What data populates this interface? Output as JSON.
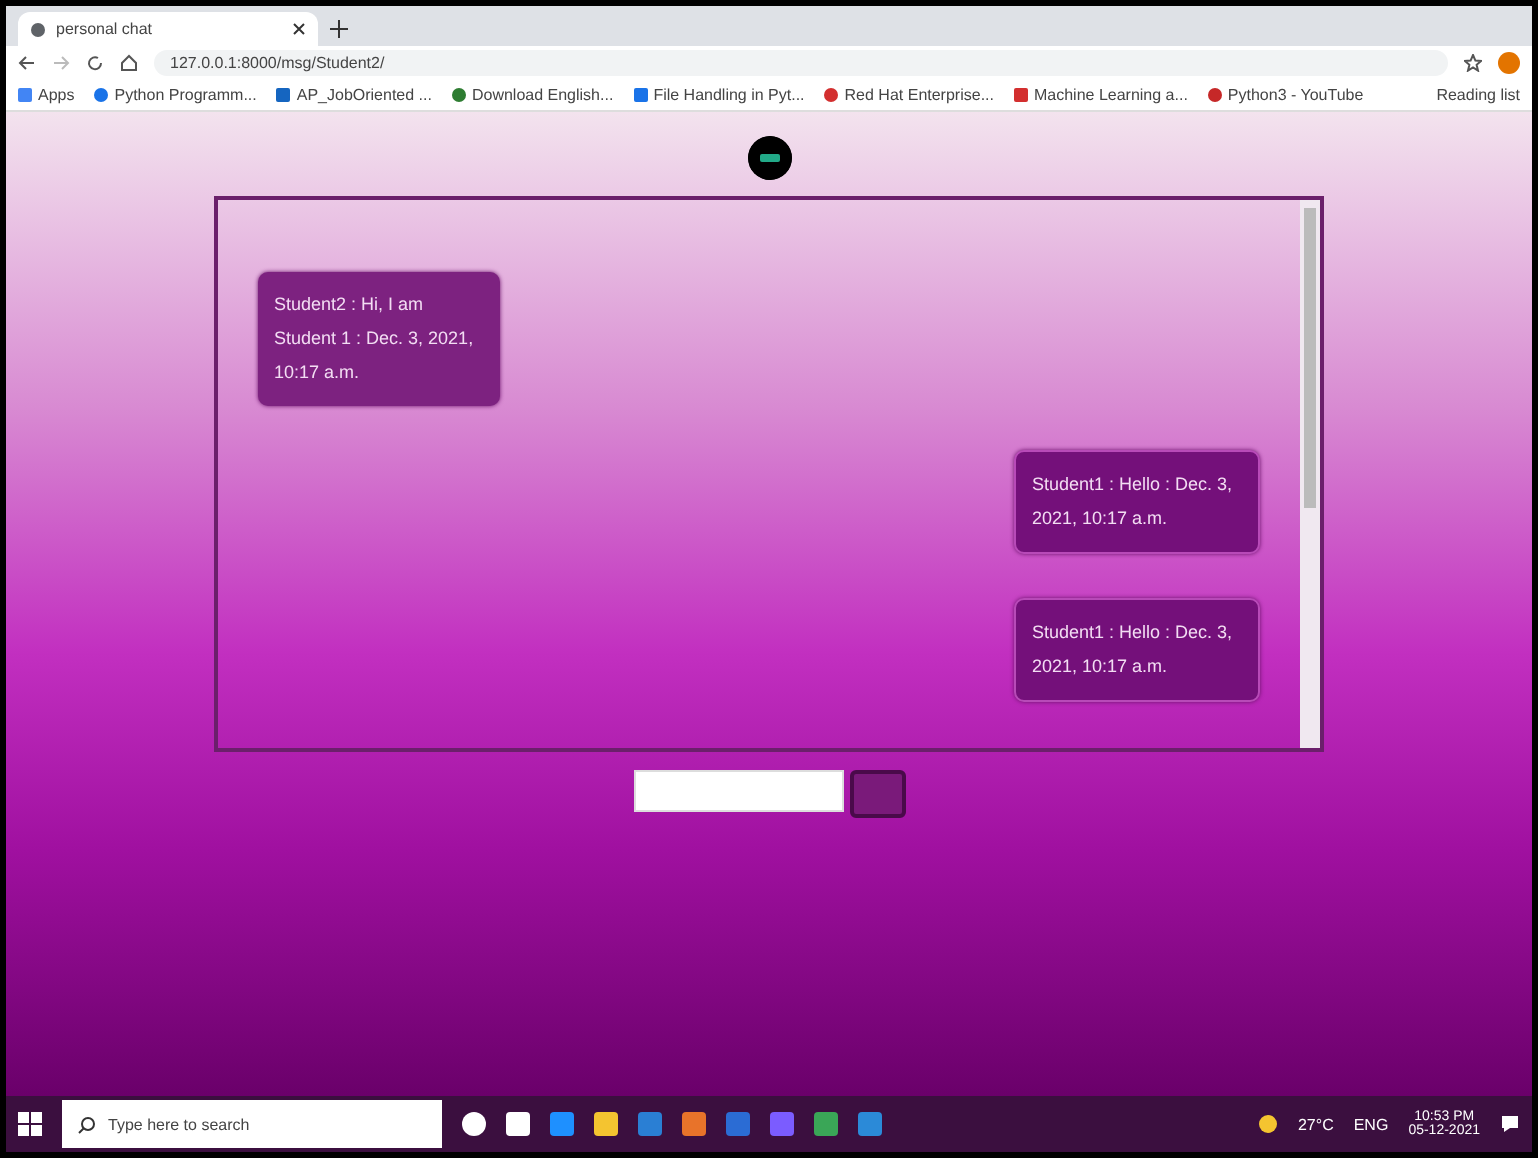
{
  "browser": {
    "tab_title": "personal chat",
    "address": "127.0.0.1:8000/msg/Student2/",
    "bookmarks": [
      "Apps",
      "Python Programm...",
      "AP_JobOriented ...",
      "Download English...",
      "File Handling in Pyt...",
      "Red Hat Enterprise...",
      "Machine Learning a...",
      "Python3 - YouTube"
    ],
    "reading_list": "Reading list"
  },
  "chat": {
    "messages": [
      {
        "text": "Student2 : Hi, I am Student 1 : Dec. 3, 2021, 10:17 a.m.",
        "outgoing": false
      },
      {
        "text": "Student1 : Hello : Dec. 3, 2021, 10:17 a.m.",
        "outgoing": true
      },
      {
        "text": "Student1 : Hello : Dec. 3, 2021, 10:17 a.m.",
        "outgoing": true
      }
    ]
  },
  "taskbar": {
    "search_placeholder": "Type here to search",
    "weather": "27°C",
    "language": "ENG",
    "time": "10:53 PM",
    "date": "05-12-2021"
  }
}
